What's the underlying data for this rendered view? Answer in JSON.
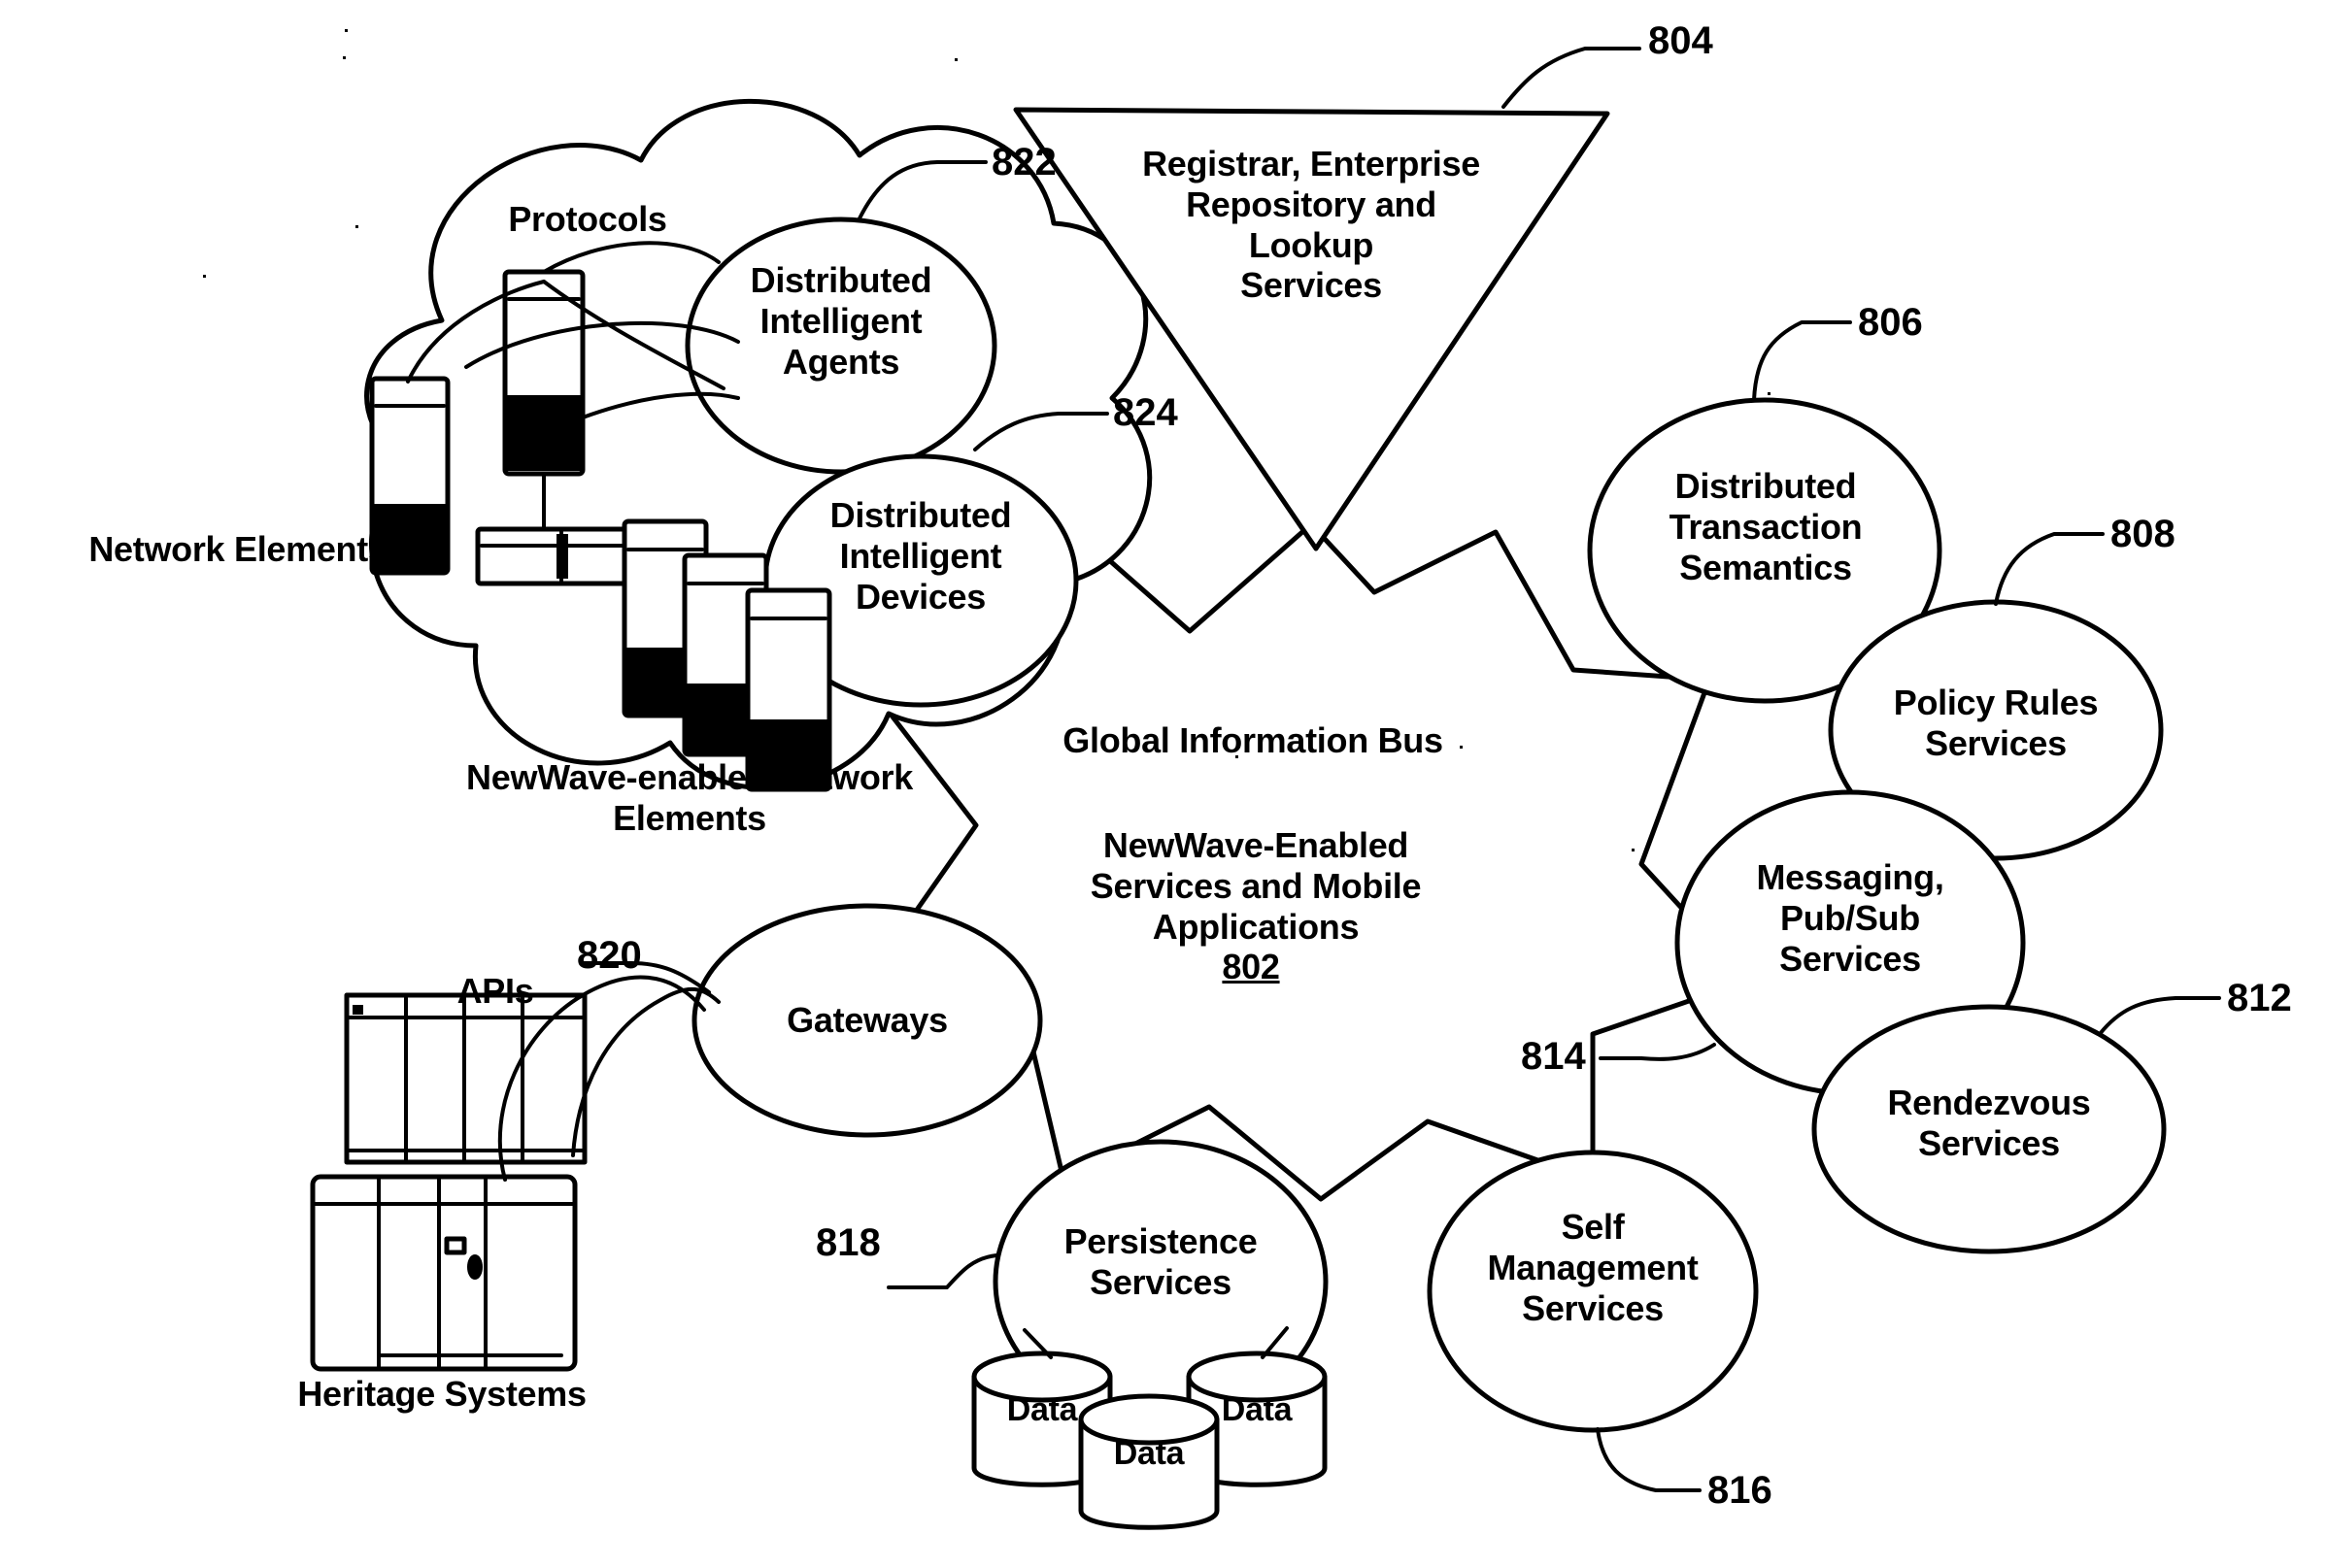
{
  "figure": {
    "type": "patent-architecture-diagram",
    "center": {
      "bus_label": "Global Information Bus",
      "subtitle": "NewWave-Enabled\nServices and Mobile\nApplications",
      "ref": "802"
    },
    "nodes": [
      {
        "id": "registrar",
        "shape": "triangle",
        "label": "Registrar, Enterprise\nRepository and\nLookup\nServices",
        "ref": "804"
      },
      {
        "id": "dts",
        "shape": "ellipse",
        "label": "Distributed\nTransaction\nSemantics",
        "ref": "806"
      },
      {
        "id": "policy",
        "shape": "ellipse",
        "label": "Policy Rules\nServices",
        "ref": "808"
      },
      {
        "id": "messaging",
        "shape": "ellipse",
        "label": "Messaging,\nPub/Sub\nServices",
        "ref": "814"
      },
      {
        "id": "rendezvous",
        "shape": "ellipse",
        "label": "Rendezvous\nServices",
        "ref": "812"
      },
      {
        "id": "selfmgmt",
        "shape": "ellipse",
        "label": "Self\nManagement\nServices",
        "ref": "816"
      },
      {
        "id": "persistence",
        "shape": "ellipse",
        "label": "Persistence\nServices",
        "ref": "818"
      },
      {
        "id": "gateways",
        "shape": "ellipse",
        "label": "Gateways",
        "ref": "820"
      },
      {
        "id": "agents",
        "shape": "ellipse",
        "label": "Distributed\nIntelligent\nAgents",
        "ref": "822"
      },
      {
        "id": "devices",
        "shape": "ellipse",
        "label": "Distributed\nIntelligent\nDevices",
        "ref": "824"
      }
    ],
    "free_labels": [
      {
        "id": "protocols",
        "text": "Protocols"
      },
      {
        "id": "network-elements",
        "text": "Network Elements"
      },
      {
        "id": "newwave-network",
        "text": "NewWave-enabled  Network\nElements"
      },
      {
        "id": "apis",
        "text": "APIs"
      },
      {
        "id": "heritage",
        "text": "Heritage Systems"
      }
    ],
    "datastores": [
      {
        "id": "data-left",
        "label": "Data"
      },
      {
        "id": "data-center",
        "label": "Data"
      },
      {
        "id": "data-right",
        "label": "Data"
      }
    ],
    "reference_numerals": [
      "802",
      "804",
      "806",
      "808",
      "812",
      "814",
      "816",
      "818",
      "820",
      "822",
      "824"
    ],
    "colors": {
      "ink": "#000000",
      "paper": "#ffffff"
    }
  }
}
